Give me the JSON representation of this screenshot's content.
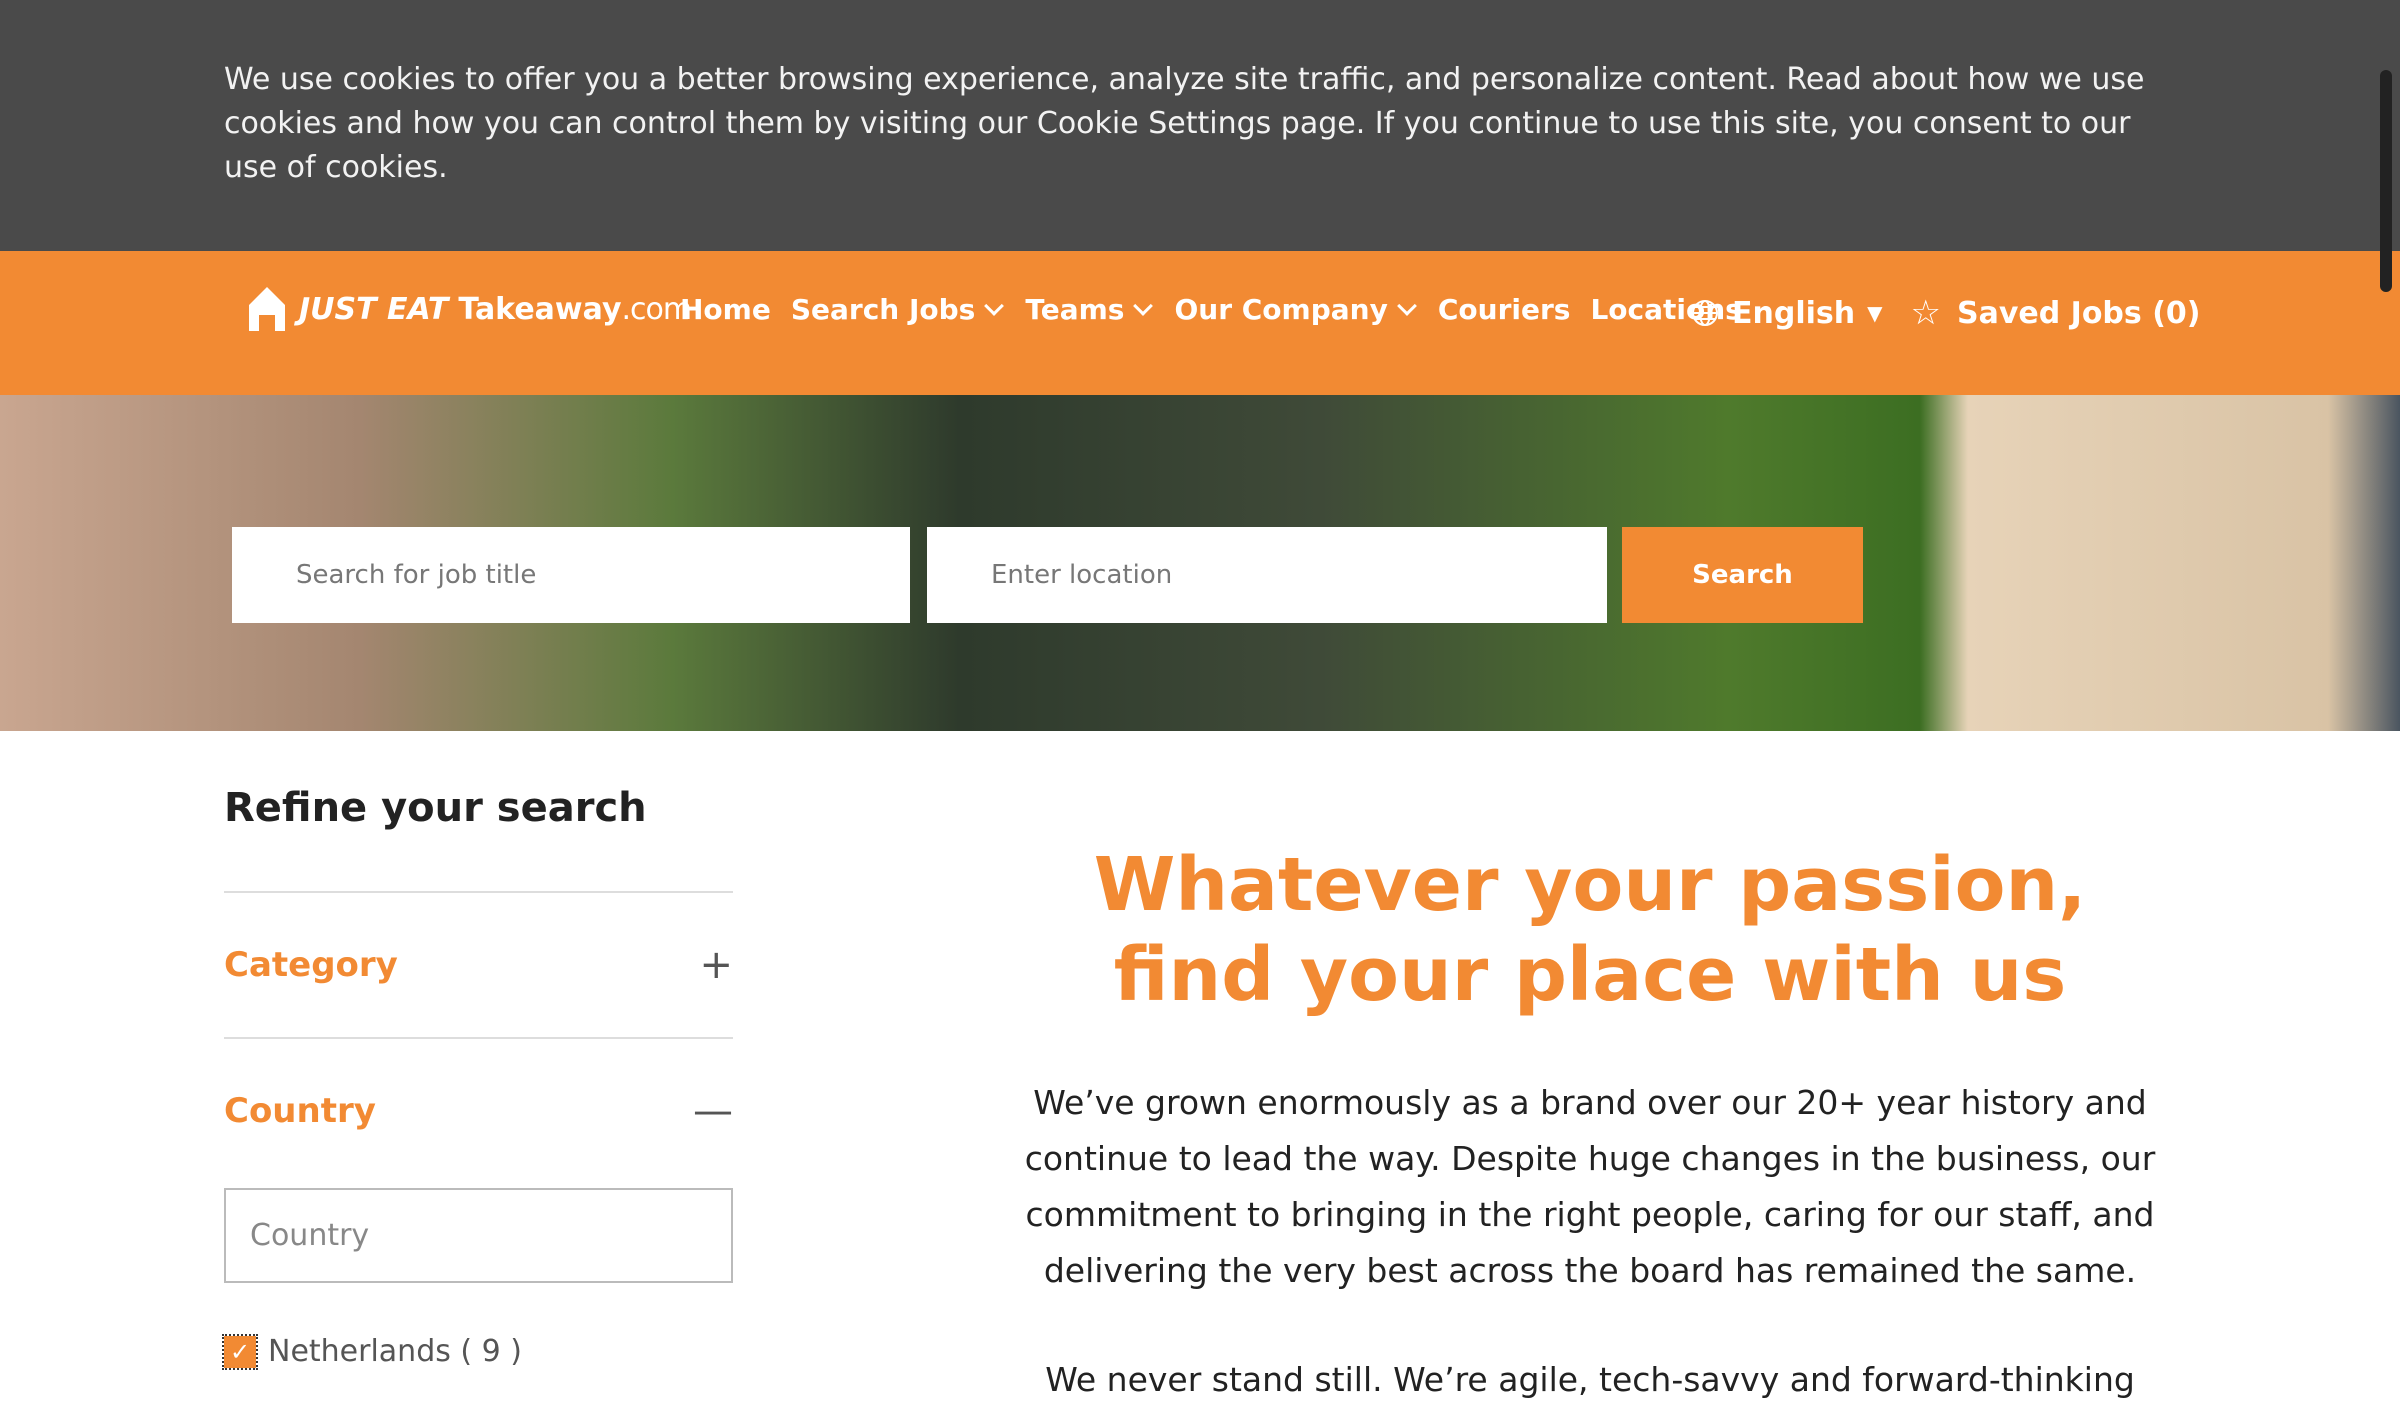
{
  "cookie": {
    "text": "We use cookies to offer you a better browsing experience, analyze site traffic, and personalize content. Read about how we use cookies and how you can control them by visiting our Cookie Settings page. If you continue to use this site, you consent to our use of cookies."
  },
  "nav": {
    "logo": {
      "brand": "JUST EAT",
      "brand2": "Takeaway",
      "suffix": ".com"
    },
    "items": [
      {
        "label": "Home"
      },
      {
        "label": "Search Jobs"
      },
      {
        "label": "Teams"
      },
      {
        "label": "Our Company"
      },
      {
        "label": "Couriers"
      },
      {
        "label": "Locations"
      }
    ],
    "language": "English",
    "saved_jobs": "Saved Jobs (0)"
  },
  "search": {
    "job_placeholder": "Search for job title",
    "location_placeholder": "Enter location",
    "button": "Search"
  },
  "sidebar": {
    "title": "Refine your search",
    "category": "Category",
    "country": "Country",
    "country_placeholder": "Country",
    "options": [
      {
        "label": "Netherlands ( 9 )",
        "checked": true
      }
    ]
  },
  "main": {
    "headline1": "Whatever your passion,",
    "headline2": "find your place with us",
    "paragraph": "We’ve grown enormously as a brand over our 20+ year history and continue to lead the way. Despite huge changes in the business, our commitment to bringing in the right people, caring for our staff, and delivering the very best across the board has remained the same.",
    "paragraph2": "We never stand still. We’re agile, tech-savvy and forward-thinking"
  },
  "colors": {
    "accent": "#f28a33",
    "cookie_bg": "#4a4a4a"
  }
}
